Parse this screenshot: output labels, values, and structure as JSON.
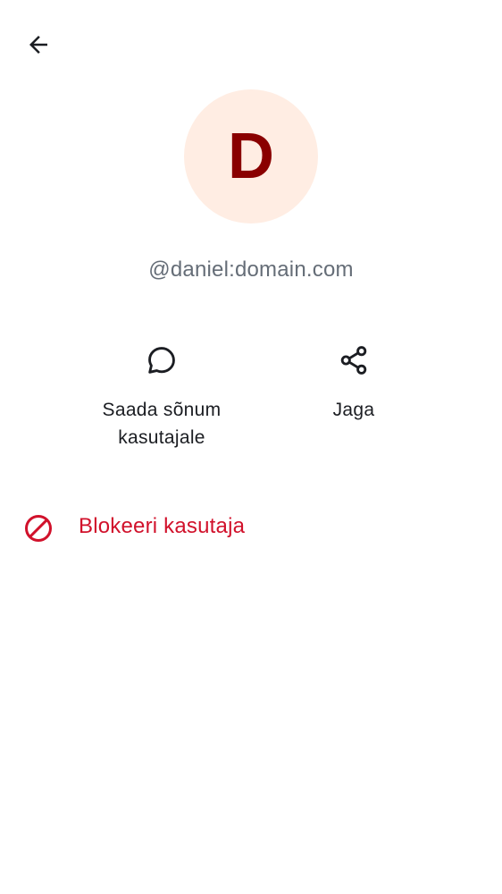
{
  "header": {
    "back_icon": "arrow-left-icon"
  },
  "profile": {
    "avatar_letter": "D",
    "avatar_bg": "#ffede3",
    "avatar_fg": "#8a0000",
    "user_id": "@daniel:domain.com"
  },
  "actions": [
    {
      "icon": "chat-bubble-icon",
      "label": "Saada sõnum kasutajale"
    },
    {
      "icon": "share-icon",
      "label": "Jaga"
    }
  ],
  "block": {
    "icon": "block-icon",
    "label": "Blokeeri kasutaja",
    "color": "#d1112b"
  }
}
